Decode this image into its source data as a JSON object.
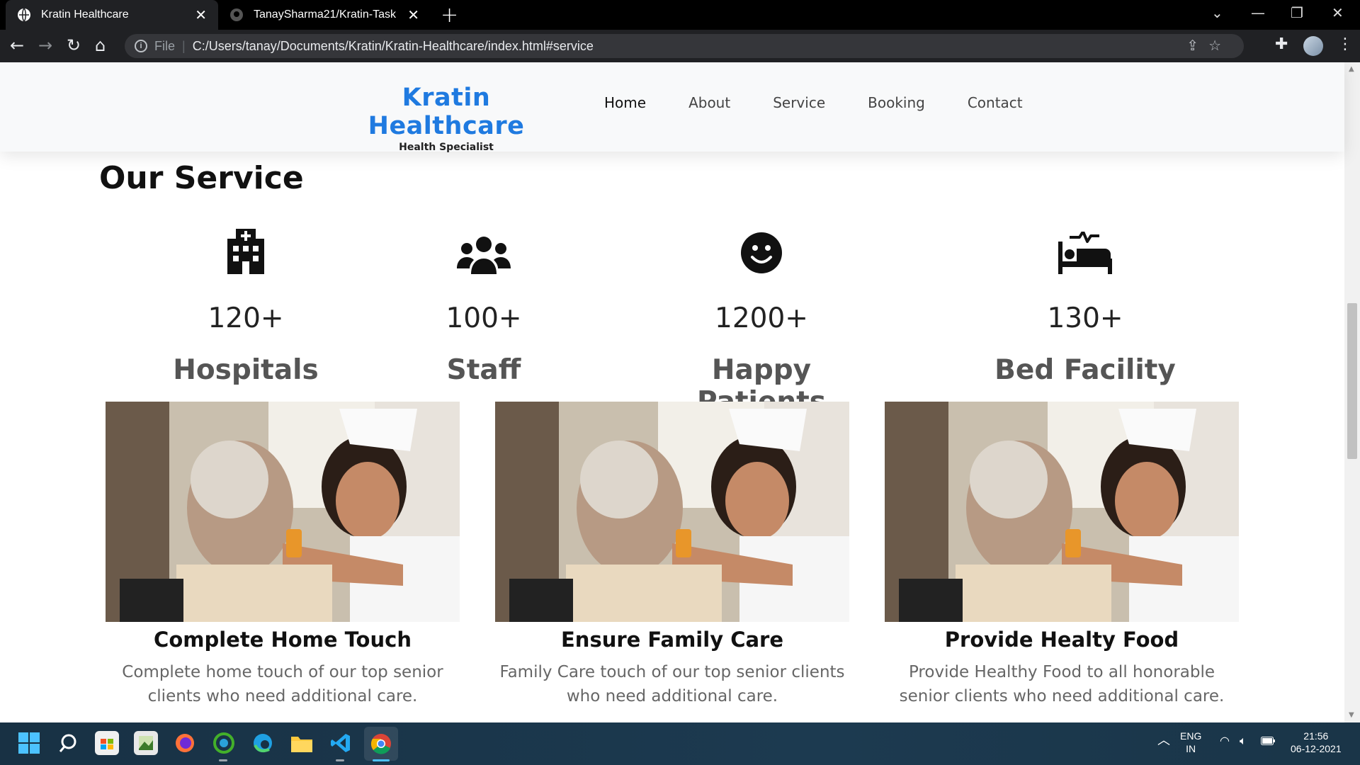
{
  "browser": {
    "tabs": [
      {
        "title": "Kratin Healthcare",
        "active": true,
        "favicon": "globe-icon"
      },
      {
        "title": "TanaySharma21/Kratin-Task",
        "active": false,
        "favicon": "github-icon"
      }
    ],
    "address": {
      "protocol": "File",
      "url": "C:/Users/tanay/Documents/Kratin/Kratin-Healthcare/index.html#service"
    }
  },
  "site": {
    "brand": {
      "name": "Kratin Healthcare",
      "tagline": "Health Specialist"
    },
    "nav": [
      "Home",
      "About",
      "Service",
      "Booking",
      "Contact"
    ],
    "active_nav": "Home",
    "section_title": "Our Service",
    "stats": [
      {
        "icon": "hospital-icon",
        "value": "120+",
        "label": "Hospitals"
      },
      {
        "icon": "users-icon",
        "value": "100+",
        "label": "Staff"
      },
      {
        "icon": "smile-icon",
        "value": "1200+",
        "label": "Happy Patients"
      },
      {
        "icon": "bed-pulse-icon",
        "value": "130+",
        "label": "Bed Facility"
      }
    ],
    "cards": [
      {
        "title": "Complete Home Touch",
        "text": "Complete home touch of our top senior clients who need additional care."
      },
      {
        "title": "Ensure Family Care",
        "text": "Family Care touch of our top senior clients who need additional care."
      },
      {
        "title": "Provide Healty Food",
        "text": "Provide Healthy Food to all honorable senior clients who need additional care."
      }
    ]
  },
  "taskbar": {
    "lang": "ENG",
    "region": "IN",
    "time": "21:56",
    "date": "06-12-2021"
  },
  "colors": {
    "brand": "#1f7ae0",
    "header_bg": "#f8f9fa",
    "chrome_bg": "#202124"
  }
}
